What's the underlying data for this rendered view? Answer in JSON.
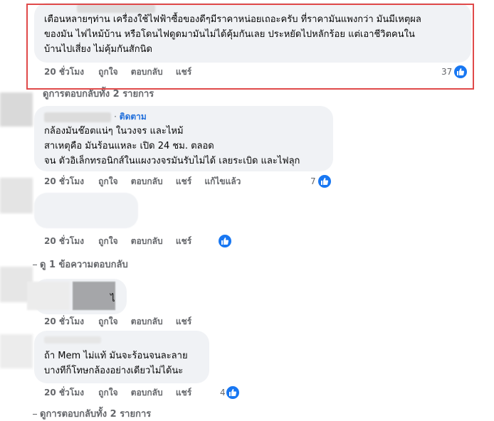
{
  "comments": [
    {
      "text_lines": [
        "เตือนหลายๆท่าน เครื่องใช้ไฟฟ้าซื้อของดีๆมีราคาหน่อยเถอะครับ ที่ราคามันแพงกว่า มันมีเหตุผล",
        "ของมัน ไฟไหม้บ้าน หรือโดนไฟดูดมามันไม่ได้คุ้มกันเลย ประหยัดไปหลักร้อย แต่เอาชีวิตคนใน",
        "บ้านไปเสี่ยง ไม่คุ้มกันสักนิด"
      ],
      "time": "20 ชั่วโมง",
      "like": "ถูกใจ",
      "reply": "ตอบกลับ",
      "share": "แชร์",
      "reactions": "37"
    },
    {
      "follow_label": "ติดตาม",
      "text_lines": [
        "กล้องมันช๊อตแน่ๆ ในวงจร และไหม้",
        "สาเหตุคือ มันร้อนแหละ เปิด 24 ชม. ตลอด",
        "จน ตัวอิเล็กทรอนิกส์ในแผงวงจรมันรับไม่ได้ เลยระเบิด และไฟลุก"
      ],
      "time": "20 ชั่วโมง",
      "like": "ถูกใจ",
      "reply": "ตอบกลับ",
      "share": "แชร์",
      "edited": "แก้ไขแล้ว",
      "reactions": "7"
    },
    {
      "time": "20 ชั่วโมง",
      "like": "ถูกใจ",
      "reply": "ตอบกลับ",
      "share": "แชร์"
    },
    {
      "text_fragment": "ไ",
      "time": "20 ชั่วโมง",
      "like": "ถูกใจ",
      "reply": "ตอบกลับ",
      "share": "แชร์"
    },
    {
      "text_lines": [
        "ถ้า Mem ไม่แท้ มันจะร้อนจนละลาย",
        "บางทีก็โทษกล้องอย่างเดียวไม่ได้นะ"
      ],
      "time": "20 ชั่วโมง",
      "like": "ถูกใจ",
      "reply": "ตอบกลับ",
      "share": "แชร์",
      "reactions": "4"
    }
  ],
  "view_replies": {
    "all_2_top": "ดูการตอบกลับทั้ง 2 รายการ",
    "one": "ดู 1 ข้อความตอบกลับ",
    "all_2_bottom": "ดูการตอบกลับทั้ง 2 รายการ"
  },
  "colors": {
    "bubble": "#f0f2f5",
    "meta_text": "#65676b",
    "like_blue": "#1877f2",
    "follow_blue": "#216fdb",
    "highlight_red": "#e04a4a"
  },
  "icons": [
    "like-thumb-icon"
  ]
}
